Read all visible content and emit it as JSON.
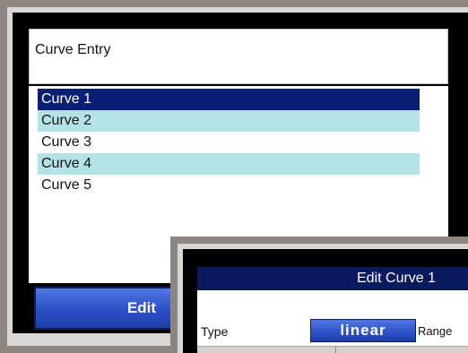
{
  "window": {
    "title": "Curve Entry"
  },
  "curve_list": {
    "items": [
      {
        "label": "Curve 1",
        "state": "selected"
      },
      {
        "label": "Curve 2",
        "state": "alt"
      },
      {
        "label": "Curve 3",
        "state": "normal"
      },
      {
        "label": "Curve 4",
        "state": "alt"
      },
      {
        "label": "Curve 5",
        "state": "normal"
      }
    ]
  },
  "buttons": {
    "edit_label": "Edit"
  },
  "dialog": {
    "title": "Edit Curve 1",
    "type_label": "Type",
    "type_value": "linear",
    "range_label": "Range"
  },
  "colors": {
    "selected_row": "#0a1f74",
    "alt_row": "#b3e3e6",
    "button_blue": "#2c50c7",
    "bezel": "#8c8683"
  }
}
